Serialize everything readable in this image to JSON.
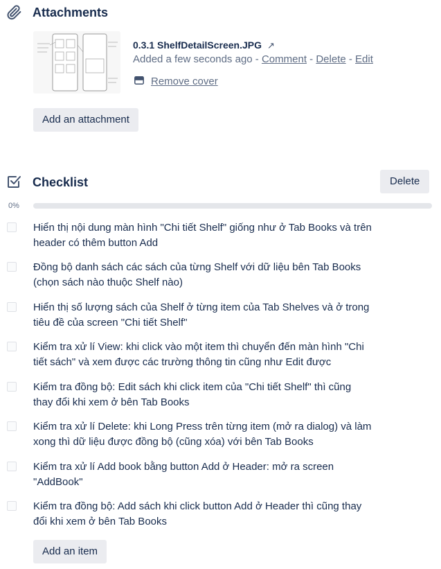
{
  "attachments": {
    "title": "Attachments",
    "file": {
      "name": "0.3.1 ShelfDetailScreen.JPG",
      "added": "Added a few seconds ago",
      "sep": " - ",
      "comment": "Comment",
      "delete": "Delete",
      "edit": "Edit"
    },
    "remove_cover": "Remove cover",
    "add_button": "Add an attachment"
  },
  "checklist": {
    "title": "Checklist",
    "delete_button": "Delete",
    "progress_text": "0%",
    "progress_value": 0,
    "items": [
      {
        "text": "Hiển thị nội dung màn hình \"Chi tiết Shelf\" giống như ở Tab Books và trên header có thêm button Add",
        "checked": false
      },
      {
        "text": "Đồng bộ danh sách các sách của từng Shelf với dữ liệu bên Tab Books (chọn sách nào thuộc Shelf nào)",
        "checked": false
      },
      {
        "text": "Hiển thị số lượng sách của Shelf ở từng item của Tab Shelves và ở trong tiêu đề của screen \"Chi tiết Shelf\"",
        "checked": false
      },
      {
        "text": "Kiểm tra xử lí View: khi click vào một item thì chuyển đến màn hình \"Chi tiết sách\" và xem được các trường thông tin cũng như Edit được",
        "checked": false
      },
      {
        "text": "Kiểm tra đồng bộ: Edit sách khi click item của \"Chi tiết Shelf\" thì cũng thay đổi khi xem ở bên Tab Books",
        "checked": false
      },
      {
        "text": "Kiểm tra xử lí Delete: khi Long Press trên từng item (mở ra dialog) và làm xong thì dữ liệu được đồng bộ (cũng xóa) với bên Tab Books",
        "checked": false
      },
      {
        "text": "Kiểm tra xử lí Add book bằng button Add ở Header: mở ra screen \"AddBook\"",
        "checked": false
      },
      {
        "text": "Kiểm tra đồng bộ: Add sách khi click button Add ở Header thì cũng thay đổi khi xem ở bên Tab Books",
        "checked": false
      }
    ],
    "add_item_button": "Add an item"
  }
}
